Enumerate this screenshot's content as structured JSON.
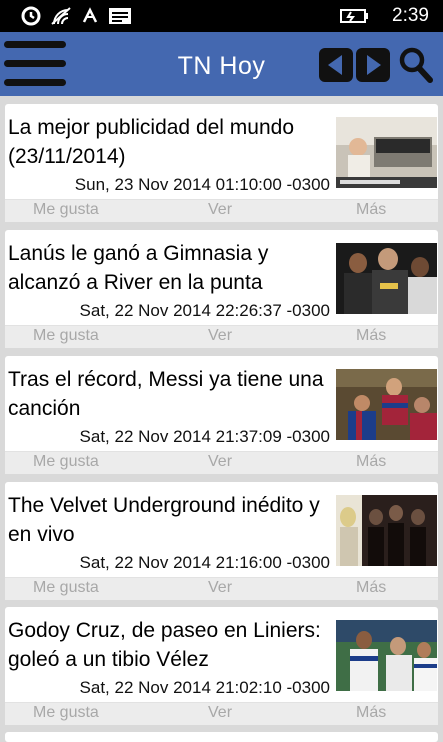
{
  "status": {
    "time": "2:39"
  },
  "header": {
    "title": "TN Hoy"
  },
  "actions": {
    "like": "Me gusta",
    "view": "Ver",
    "more": "Más"
  },
  "articles": [
    {
      "title": "La mejor publicidad del mundo (23/11/2014)",
      "date": "Sun, 23 Nov 2014 01:10:00 -0300"
    },
    {
      "title": "Lanús le ganó a Gimnasia y alcanzó a River en la punta",
      "date": "Sat, 22 Nov 2014 22:26:37 -0300"
    },
    {
      "title": "Tras el récord, Messi ya tiene una canción",
      "date": "Sat, 22 Nov 2014 21:37:09 -0300"
    },
    {
      "title": "The Velvet Underground inédito y en vivo",
      "date": "Sat, 22 Nov 2014 21:16:00 -0300"
    },
    {
      "title": "Godoy Cruz, de paseo en Liniers: goleó a un tibio Vélez",
      "date": "Sat, 22 Nov 2014 21:02:10 -0300"
    }
  ],
  "colors": {
    "header": "#4468b0",
    "background": "#d9d9d9",
    "action_text": "#a8a8a8"
  }
}
